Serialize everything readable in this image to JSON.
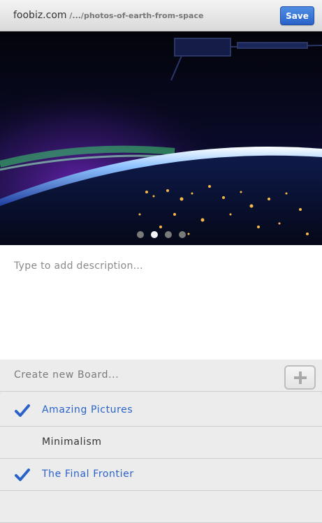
{
  "header": {
    "domain": "foobiz.com",
    "path": " /.../photos-of-earth-from-space",
    "save_label": "Save"
  },
  "carousel": {
    "dot_count": 4,
    "active_index": 1
  },
  "description": {
    "placeholder": "Type to add description..."
  },
  "boards": {
    "create_placeholder": "Create new Board...",
    "items": [
      {
        "label": "Amazing Pictures",
        "selected": true
      },
      {
        "label": "Minimalism",
        "selected": false
      },
      {
        "label": "The Final Frontier",
        "selected": true
      }
    ]
  },
  "colors": {
    "accent": "#2a62c9",
    "header_bg": "#dedede",
    "list_bg": "#ececec"
  }
}
